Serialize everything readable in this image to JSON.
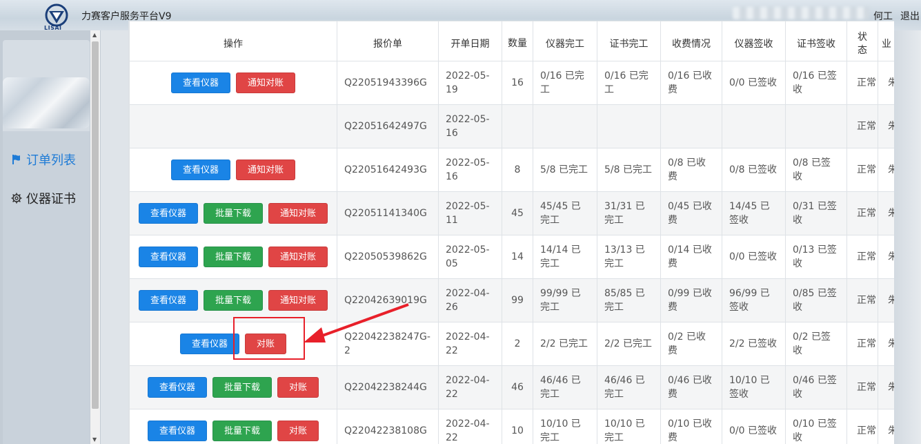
{
  "header": {
    "logo_text": "LISAI",
    "title": "力赛客户服务平台V9",
    "user": "何工",
    "logout": "退出"
  },
  "sidebar": {
    "items": [
      {
        "label": "订单列表",
        "icon": "flag-icon",
        "active": true
      },
      {
        "label": "仪器证书",
        "icon": "gear-icon",
        "active": false
      }
    ]
  },
  "table": {
    "headers": [
      "操作",
      "报价单",
      "开单日期",
      "数量",
      "仪器完工",
      "证书完工",
      "收费情况",
      "仪器签收",
      "证书签收",
      "状态",
      "业"
    ],
    "rows": [
      {
        "buttons": [
          {
            "label": "查看仪器",
            "style": "blue"
          },
          {
            "label": "通知对账",
            "style": "red"
          }
        ],
        "quote": "Q22051943396G",
        "date": "2022-05-19",
        "qty": "16",
        "inst_done": "0/16 已完工",
        "cert_done": "0/16 已完工",
        "fee": "0/16 已收费",
        "inst_sign": "0/0 已签收",
        "cert_sign": "0/16 已签收",
        "status": "正常",
        "biz": "朱"
      },
      {
        "buttons": [],
        "quote": "Q22051642497G",
        "date": "2022-05-16",
        "qty": "",
        "inst_done": "",
        "cert_done": "",
        "fee": "",
        "inst_sign": "",
        "cert_sign": "",
        "status": "正常",
        "biz": "朱"
      },
      {
        "buttons": [
          {
            "label": "查看仪器",
            "style": "blue"
          },
          {
            "label": "通知对账",
            "style": "red"
          }
        ],
        "quote": "Q22051642493G",
        "date": "2022-05-16",
        "qty": "8",
        "inst_done": "5/8 已完工",
        "cert_done": "5/8 已完工",
        "fee": "0/8 已收费",
        "inst_sign": "0/8 已签收",
        "cert_sign": "0/8 已签收",
        "status": "正常",
        "biz": "朱"
      },
      {
        "buttons": [
          {
            "label": "查看仪器",
            "style": "blue"
          },
          {
            "label": "批量下载",
            "style": "green"
          },
          {
            "label": "通知对账",
            "style": "red"
          }
        ],
        "quote": "Q22051141340G",
        "date": "2022-05-11",
        "qty": "45",
        "inst_done": "45/45 已完工",
        "cert_done": "31/31 已完工",
        "fee": "0/45 已收费",
        "inst_sign": "14/45 已签收",
        "cert_sign": "0/31 已签收",
        "status": "正常",
        "biz": "朱"
      },
      {
        "buttons": [
          {
            "label": "查看仪器",
            "style": "blue"
          },
          {
            "label": "批量下载",
            "style": "green"
          },
          {
            "label": "通知对账",
            "style": "red"
          }
        ],
        "quote": "Q22050539862G",
        "date": "2022-05-05",
        "qty": "14",
        "inst_done": "14/14 已完工",
        "cert_done": "13/13 已完工",
        "fee": "0/14 已收费",
        "inst_sign": "0/0 已签收",
        "cert_sign": "0/13 已签收",
        "status": "正常",
        "biz": "朱"
      },
      {
        "buttons": [
          {
            "label": "查看仪器",
            "style": "blue"
          },
          {
            "label": "批量下载",
            "style": "green"
          },
          {
            "label": "通知对账",
            "style": "red"
          }
        ],
        "quote": "Q22042639019G",
        "date": "2022-04-26",
        "qty": "99",
        "inst_done": "99/99 已完工",
        "cert_done": "85/85 已完工",
        "fee": "0/99 已收费",
        "inst_sign": "96/99 已签收",
        "cert_sign": "0/85 已签收",
        "status": "正常",
        "biz": "朱"
      },
      {
        "buttons": [
          {
            "label": "查看仪器",
            "style": "blue"
          },
          {
            "label": "对账",
            "style": "red"
          }
        ],
        "quote": "Q22042238247G-2",
        "date": "2022-04-22",
        "qty": "2",
        "inst_done": "2/2 已完工",
        "cert_done": "2/2 已完工",
        "fee": "0/2 已收费",
        "inst_sign": "2/2 已签收",
        "cert_sign": "0/2 已签收",
        "status": "正常",
        "biz": "朱"
      },
      {
        "buttons": [
          {
            "label": "查看仪器",
            "style": "blue"
          },
          {
            "label": "批量下载",
            "style": "green"
          },
          {
            "label": "对账",
            "style": "red"
          }
        ],
        "quote": "Q22042238244G",
        "date": "2022-04-22",
        "qty": "46",
        "inst_done": "46/46 已完工",
        "cert_done": "46/46 已完工",
        "fee": "0/46 已收费",
        "inst_sign": "10/10 已签收",
        "cert_sign": "0/46 已签收",
        "status": "正常",
        "biz": "朱"
      },
      {
        "buttons": [
          {
            "label": "查看仪器",
            "style": "blue"
          },
          {
            "label": "批量下载",
            "style": "green"
          },
          {
            "label": "对账",
            "style": "red"
          }
        ],
        "quote": "Q22042238108G",
        "date": "2022-04-22",
        "qty": "10",
        "inst_done": "10/10 已完工",
        "cert_done": "10/10 已完工",
        "fee": "0/10 已收费",
        "inst_sign": "0/0 已签收",
        "cert_sign": "0/10 已签收",
        "status": "正常",
        "biz": "朱"
      }
    ]
  },
  "colors": {
    "accent": "#1a84e6",
    "success": "#2ea44f",
    "danger": "#e04545",
    "annotation": "#e8202a"
  }
}
